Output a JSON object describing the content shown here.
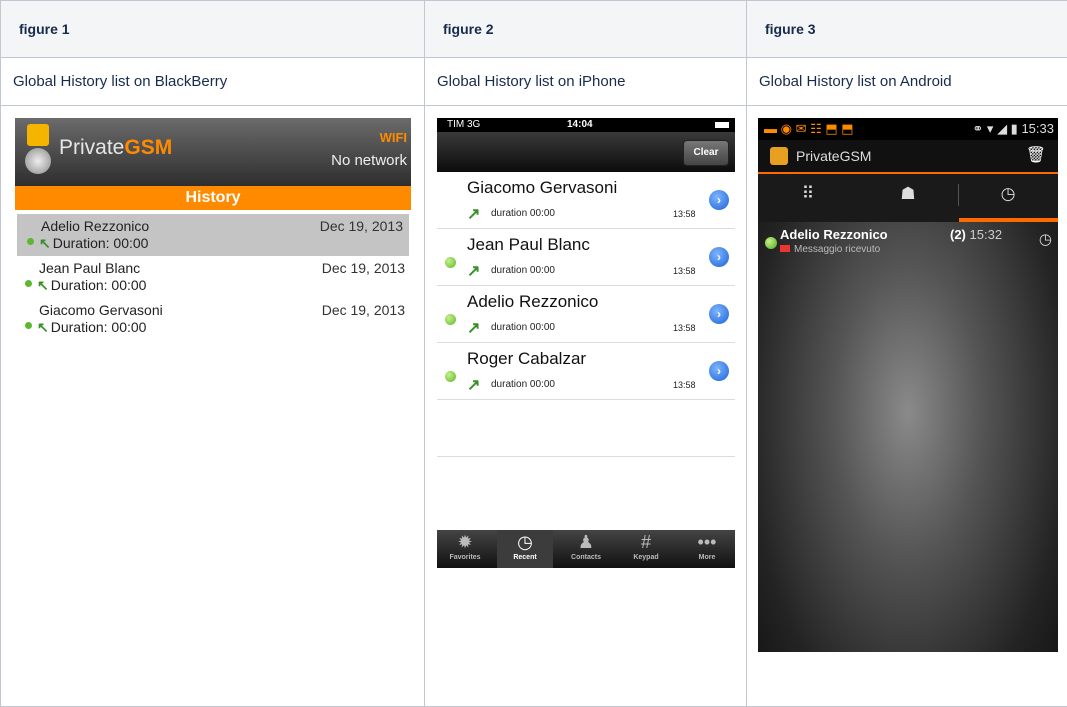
{
  "headers": [
    "figure 1",
    "figure 2",
    "figure 3"
  ],
  "captions": [
    "Global History list on BlackBerry",
    "Global History list on iPhone",
    "Global History list on Android"
  ],
  "blackberry": {
    "app_name_prefix": "Private",
    "app_name_suffix": "GSM",
    "wifi": "WIFI",
    "network": "No network",
    "bar_title": "History",
    "rows": [
      {
        "name": "Adelio Rezzonico",
        "date": "Dec 19, 2013",
        "duration": "Duration:  00:00"
      },
      {
        "name": "Jean Paul Blanc",
        "date": "Dec 19, 2013",
        "duration": "Duration:  00:00"
      },
      {
        "name": "Giacomo Gervasoni",
        "date": "Dec 19, 2013",
        "duration": "Duration:  00:00"
      }
    ]
  },
  "iphone": {
    "carrier": "TIM  3G",
    "time": "14:04",
    "clear_label": "Clear",
    "rows": [
      {
        "name": "Giacomo Gervasoni",
        "duration": "duration 00:00",
        "time": "13:58"
      },
      {
        "name": "Jean Paul Blanc",
        "duration": "duration 00:00",
        "time": "13:58"
      },
      {
        "name": "Adelio Rezzonico",
        "duration": "duration 00:00",
        "time": "13:58"
      },
      {
        "name": "Roger Cabalzar",
        "duration": "duration 00:00",
        "time": "13:58"
      }
    ],
    "tabs": [
      "Favorites",
      "Recent",
      "Contacts",
      "Keypad",
      "More"
    ]
  },
  "android": {
    "clock": "15:33",
    "app_name": "PrivateGSM",
    "row": {
      "name": "Adelio Rezzonico",
      "count": "(2)",
      "time": "15:32",
      "message": "Messaggio ricevuto"
    }
  }
}
